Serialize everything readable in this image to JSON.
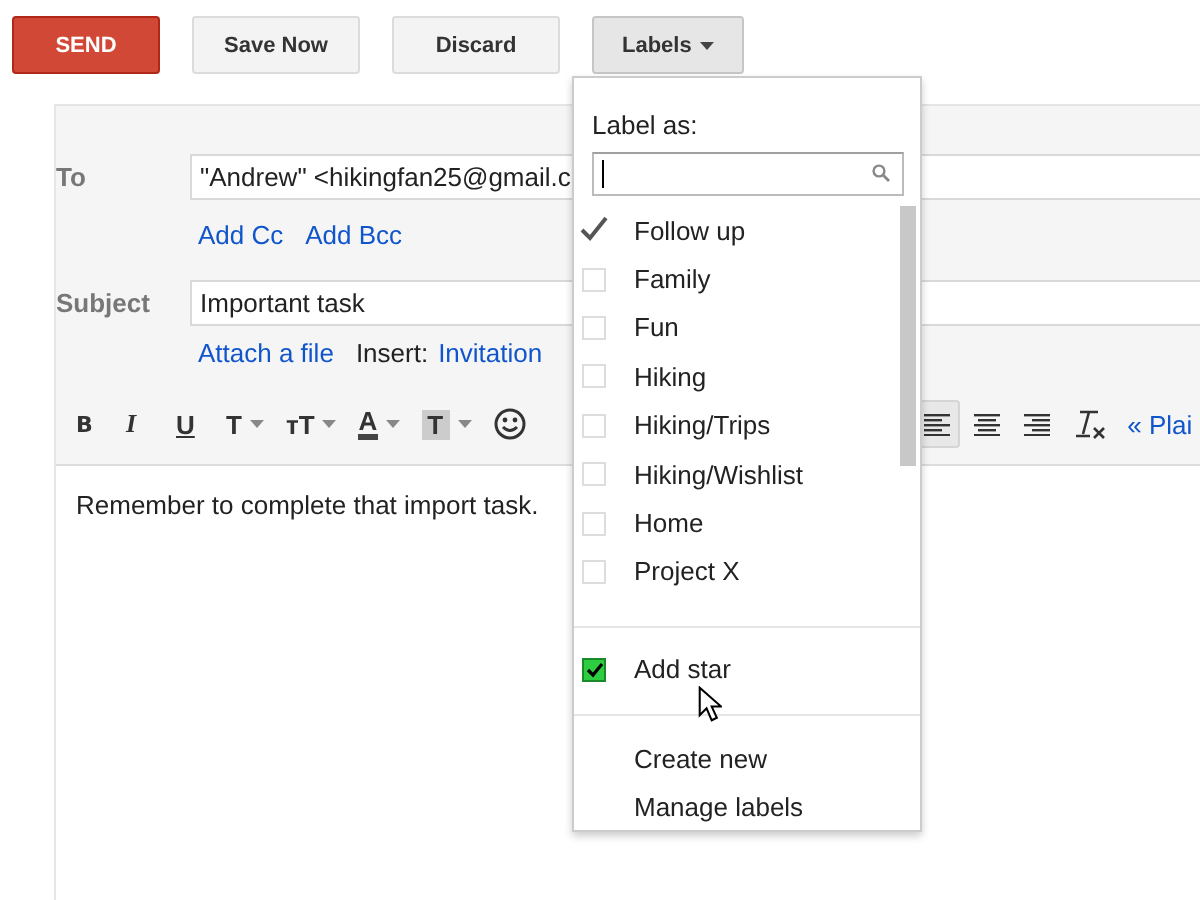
{
  "actions": [
    {
      "label": "SEND",
      "kind": "primary"
    },
    {
      "label": "Save Now",
      "kind": "plain"
    },
    {
      "label": "Discard",
      "kind": "plain"
    },
    {
      "label": "Labels",
      "kind": "menu",
      "expanded": true
    }
  ],
  "to": {
    "label": "To",
    "value": "\"Andrew\" <hikingfan25@gmail.c"
  },
  "recipient_links": [
    "Add Cc",
    "Add Bcc"
  ],
  "subject": {
    "label": "Subject",
    "value": "Important task"
  },
  "attach_link": "Attach a file",
  "insert_label": "Insert:",
  "insert_link": "Invitation",
  "toolbar_left": [
    {
      "kind": "bold",
      "label": "B",
      "dropdown": false,
      "selected": false
    },
    {
      "kind": "italic",
      "label": "I",
      "dropdown": false,
      "selected": false
    },
    {
      "kind": "underline",
      "label": "U",
      "dropdown": false,
      "selected": false
    },
    {
      "kind": "font",
      "label": "T",
      "dropdown": true,
      "selected": false
    },
    {
      "kind": "size",
      "label": "тT",
      "dropdown": true,
      "selected": false
    },
    {
      "kind": "color",
      "label": "A",
      "dropdown": true,
      "selected": false
    },
    {
      "kind": "highlight",
      "label": "T",
      "dropdown": true,
      "selected": false
    },
    {
      "kind": "emoji",
      "dropdown": false,
      "selected": false
    }
  ],
  "toolbar_right": [
    {
      "kind": "align-left",
      "dropdown": false,
      "selected": true
    },
    {
      "kind": "align-center",
      "dropdown": false,
      "selected": false
    },
    {
      "kind": "align-right",
      "dropdown": false,
      "selected": false
    },
    {
      "kind": "clear-format",
      "dropdown": false,
      "selected": false
    }
  ],
  "plain_link": "« Plai",
  "body": "Remember to complete that import task.",
  "label_menu": {
    "title": "Label as:",
    "labels": [
      {
        "label": "Follow up",
        "checked": true
      },
      {
        "label": "Family",
        "checked": false
      },
      {
        "label": "Fun",
        "checked": false
      },
      {
        "label": "Hiking",
        "checked": false
      },
      {
        "label": "Hiking/Trips",
        "checked": false
      },
      {
        "label": "Hiking/Wishlist",
        "checked": false
      },
      {
        "label": "Home",
        "checked": false
      },
      {
        "label": "Project X",
        "checked": false
      }
    ],
    "star": {
      "label": "Add star",
      "checked": true
    },
    "commands": [
      "Create new",
      "Manage labels"
    ]
  }
}
